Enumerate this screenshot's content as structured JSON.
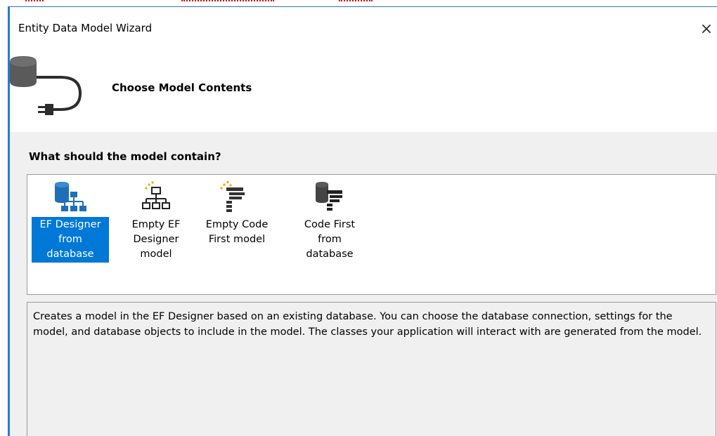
{
  "window": {
    "title": "Entity Data Model Wizard",
    "close_glyph": "×",
    "accent_color": "#2b78d6"
  },
  "header": {
    "heading": "Choose Model Contents",
    "icon": "database-plug-icon"
  },
  "body": {
    "question": "What should the model contain?",
    "options": [
      {
        "label": "EF Designer\nfrom\ndatabase",
        "icon": "database-hierarchy-icon",
        "selected": true
      },
      {
        "label": "Empty EF\nDesigner\nmodel",
        "icon": "empty-hierarchy-icon",
        "selected": false
      },
      {
        "label": "Empty Code\nFirst model",
        "icon": "empty-code-icon",
        "selected": false
      },
      {
        "label": "Code First\nfrom\ndatabase",
        "icon": "database-code-icon",
        "selected": false
      }
    ],
    "description": "Creates a model in the EF Designer based on an existing database. You can choose the database connection, settings for the model, and database objects to include in the model. The classes your application will interact with are generated from the model.",
    "selection_color": "#0078d7"
  }
}
